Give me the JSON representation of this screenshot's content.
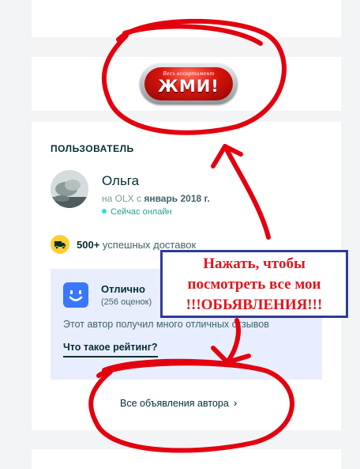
{
  "banner": {
    "sub_label": "Весь ассортимент",
    "main_label": "ЖМИ!"
  },
  "user_section": {
    "title": "ПОЛЬЗОВАТЕЛЬ",
    "name": "Ольга",
    "since_prefix": "на OLX с",
    "since_date": "январь 2018 г.",
    "online_status": "Сейчас онлайн",
    "deliveries_count": "500+",
    "deliveries_label": "успешных доставок"
  },
  "rating": {
    "title": "Отлично",
    "count": "(256 оценок)",
    "description": "Этот автор получил много отличных отзывов",
    "link": "Что такое рейтинг?"
  },
  "all_ads": {
    "label": "Все объявления автора"
  },
  "annotation": {
    "lines": [
      "Нажать, чтобы",
      "посмотреть все мои",
      "!!!ОБЬЯВЛЕНИЯ!!!"
    ],
    "text_color": "#e0151c",
    "stroke_color": "#e3000f",
    "box_color": "#2f3a9a"
  },
  "colors": {
    "background": "#f2f4f5",
    "card": "#ffffff",
    "primary_text": "#002f34",
    "online": "#23e5db",
    "rating_bg": "#e8eefd",
    "rating_icon": "#3a77ff",
    "delivery_icon": "#ffce32"
  }
}
